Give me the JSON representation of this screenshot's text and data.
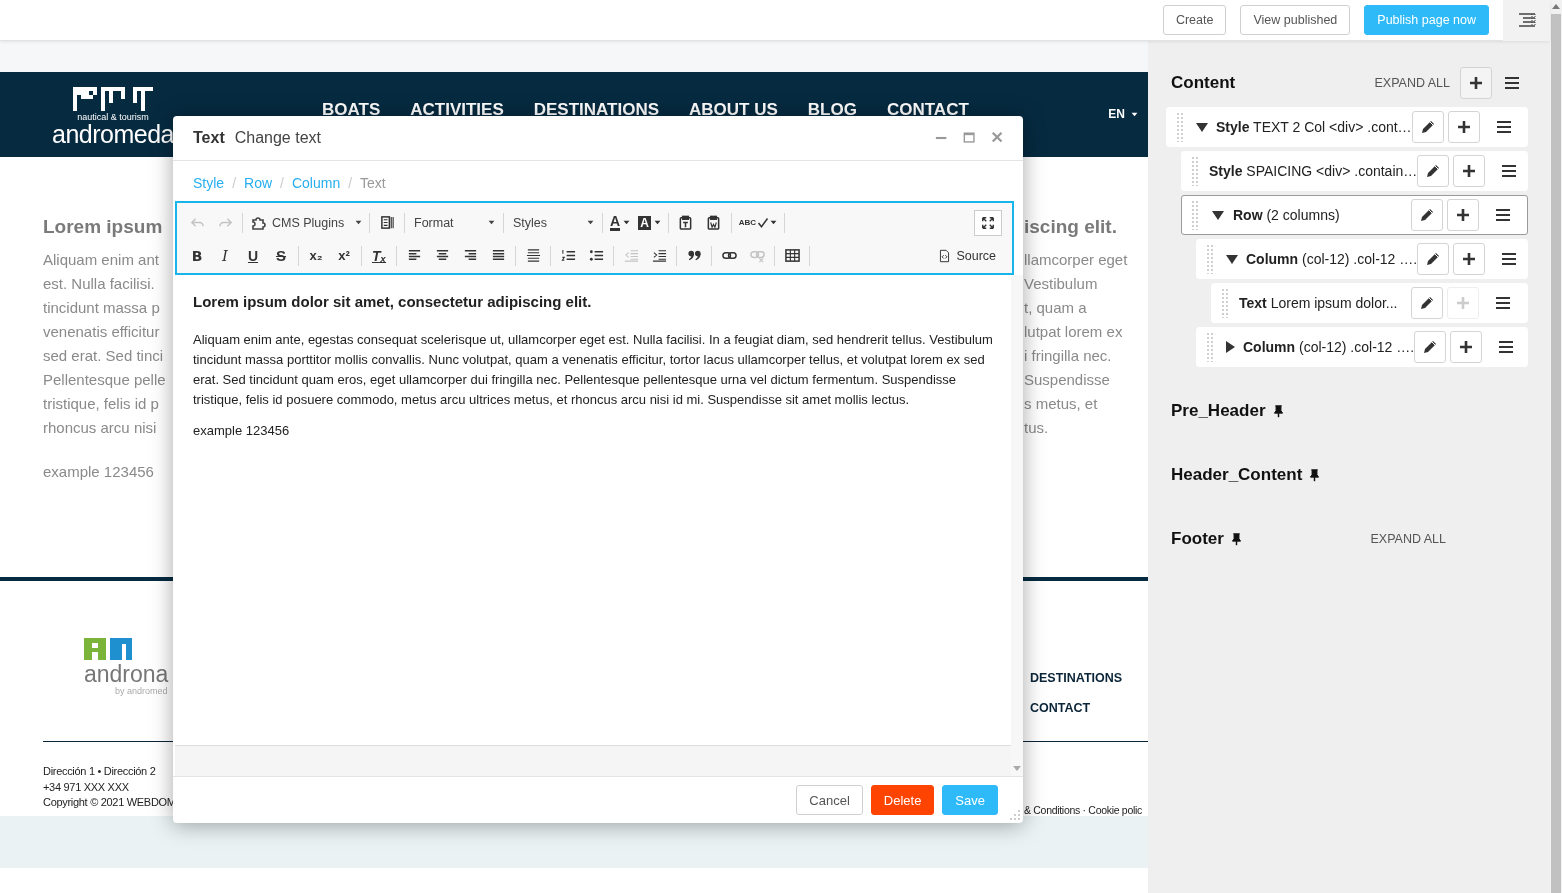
{
  "topbar": {
    "buttons": [
      {
        "label": "Create",
        "kind": "default"
      },
      {
        "label": "View published",
        "kind": "default"
      },
      {
        "label": "Publish page now",
        "kind": "primary"
      }
    ]
  },
  "site": {
    "logo": {
      "tagline": "nautical & tourism",
      "name": "andromeda"
    },
    "nav": [
      "BOATS",
      "ACTIVITIES",
      "DESTINATIONS",
      "ABOUT US",
      "BLOG",
      "CONTACT"
    ],
    "language": "EN",
    "body_left": {
      "heading": "Lorem ipsum",
      "lines": [
        "Aliquam enim ant",
        "est. Nulla facilisi.",
        "tincidunt massa p",
        "venenatis efficitur",
        "sed erat. Sed tinci",
        "Pellentesque pelle",
        "tristique, felis id p",
        "rhoncus arcu nisi"
      ],
      "example": "example 123456"
    },
    "body_right": {
      "heading": "iscing elit.",
      "lines": [
        "llamcorper eget",
        "Vestibulum",
        "t, quam a",
        "lutpat lorem ex",
        "i fringilla nec.",
        "Suspendisse",
        "s metus, et",
        "tus."
      ]
    },
    "footer": {
      "logo": {
        "name": "androna",
        "tagline": "by andromed"
      },
      "links": [
        "DESTINATIONS",
        "CONTACT"
      ],
      "address": [
        "Dirección 1 • Dirección 2",
        "+34 971 XXX XXX",
        "Copyright © 2021 WEBDOM"
      ],
      "legal": "& Conditions · Cookie polic"
    }
  },
  "modal": {
    "title": "Text",
    "subtitle": "Change text",
    "breadcrumb": [
      {
        "label": "Style",
        "selected": false
      },
      {
        "label": "Row",
        "selected": false
      },
      {
        "label": "Column",
        "selected": false
      },
      {
        "label": "Text",
        "selected": true
      }
    ],
    "separator": "/",
    "toolbar": [
      {
        "groups": [
          [
            {
              "kind": "undo",
              "disabled": true
            },
            {
              "kind": "redo",
              "disabled": true
            }
          ],
          [
            {
              "kind": "plugins",
              "label": "CMS Plugins",
              "disabled": false
            }
          ],
          [
            {
              "kind": "blocks",
              "disabled": false
            }
          ],
          [
            {
              "kind": "format",
              "label": "Format",
              "disabled": false
            }
          ],
          [
            {
              "kind": "styles",
              "label": "Styles",
              "disabled": false
            }
          ],
          [
            {
              "kind": "textcolor",
              "label": "A",
              "disabled": false
            },
            {
              "kind": "bgcolor",
              "label": "A",
              "disabled": false
            }
          ],
          [
            {
              "kind": "pastetext",
              "disabled": false
            },
            {
              "kind": "pasteword",
              "disabled": false
            }
          ],
          [
            {
              "kind": "spellcheck",
              "label": "ABC",
              "disabled": false
            }
          ]
        ],
        "end": [
          {
            "kind": "maximize",
            "disabled": false
          }
        ]
      },
      {
        "groups": [
          [
            {
              "kind": "bold",
              "label": "B",
              "disabled": false
            },
            {
              "kind": "italic",
              "label": "I",
              "disabled": false
            },
            {
              "kind": "underline",
              "label": "U",
              "disabled": false
            },
            {
              "kind": "strike",
              "label": "S",
              "disabled": false
            }
          ],
          [
            {
              "kind": "subscript",
              "label": "x₂",
              "disabled": false
            },
            {
              "kind": "superscript",
              "label": "x²",
              "disabled": false
            }
          ],
          [
            {
              "kind": "removeformat",
              "label": "Tₓ",
              "disabled": false
            }
          ],
          [
            {
              "kind": "alignleft",
              "disabled": false
            },
            {
              "kind": "aligncenter",
              "disabled": false
            },
            {
              "kind": "alignright",
              "disabled": false
            },
            {
              "kind": "justify",
              "disabled": false
            }
          ],
          [
            {
              "kind": "hr",
              "disabled": false
            }
          ],
          [
            {
              "kind": "ol",
              "disabled": false
            },
            {
              "kind": "ul",
              "disabled": false
            }
          ],
          [
            {
              "kind": "outdent",
              "disabled": true
            },
            {
              "kind": "indent",
              "disabled": false
            }
          ],
          [
            {
              "kind": "quote",
              "disabled": false
            }
          ],
          [
            {
              "kind": "link",
              "disabled": false
            },
            {
              "kind": "unlink",
              "disabled": true
            }
          ],
          [
            {
              "kind": "table",
              "disabled": false
            }
          ]
        ],
        "end": [
          {
            "kind": "source",
            "label": "Source",
            "disabled": false
          }
        ]
      }
    ],
    "content": {
      "heading": "Lorem ipsum dolor sit amet, consectetur adipiscing elit.",
      "paragraph": "Aliquam enim ante, egestas consequat scelerisque ut, ullamcorper eget est. Nulla facilisi. In a feugiat diam, sed hendrerit tellus. Vestibulum tincidunt massa porttitor mollis convallis. Nunc volutpat, quam a venenatis efficitur, tortor lacus ullamcorper tellus, et volutpat lorem ex sed erat. Sed tincidunt quam eros, eget ullamcorper dui fringilla nec. Pellentesque pellentesque urna vel dictum fermentum. Suspendisse tristique, felis id posuere commodo, metus arcu ultrices metus, et rhoncus arcu nisi id mi. Suspendisse sit amet mollis lectus.",
      "extra": "example 123456"
    },
    "buttons": [
      {
        "label": "Cancel",
        "kind": "default"
      },
      {
        "label": "Delete",
        "kind": "danger"
      },
      {
        "label": "Save",
        "kind": "primary"
      }
    ]
  },
  "panel": {
    "sections": [
      {
        "kind": "tree",
        "title": "Content",
        "expand_all": "EXPAND ALL",
        "tree": [
          {
            "type": "Style",
            "text": "TEXT 2 Col <div> .cont…",
            "expanded": true,
            "selected": false,
            "add_disabled": false,
            "children": [
              {
                "type": "Style",
                "text": "SPAICING <div> .contain…",
                "selected": false,
                "add_disabled": false
              },
              {
                "type": "Row",
                "text": "(2 columns)",
                "expanded": true,
                "selected": true,
                "add_disabled": false,
                "children": [
                  {
                    "type": "Column",
                    "text": "(col-12) .col-12 ….",
                    "expanded": true,
                    "selected": false,
                    "add_disabled": false,
                    "children": [
                      {
                        "type": "Text",
                        "text": "Lorem ipsum dolor...",
                        "selected": false,
                        "add_disabled": true
                      }
                    ]
                  },
                  {
                    "type": "Column",
                    "text": "(col-12) .col-12 ….",
                    "expanded": false,
                    "selected": false,
                    "add_disabled": false
                  }
                ]
              }
            ]
          }
        ]
      },
      {
        "kind": "placeholder",
        "title": "Pre_Header"
      },
      {
        "kind": "placeholder",
        "title": "Header_Content"
      },
      {
        "kind": "placeholder",
        "title": "Footer",
        "expand_all": "EXPAND ALL"
      }
    ]
  }
}
